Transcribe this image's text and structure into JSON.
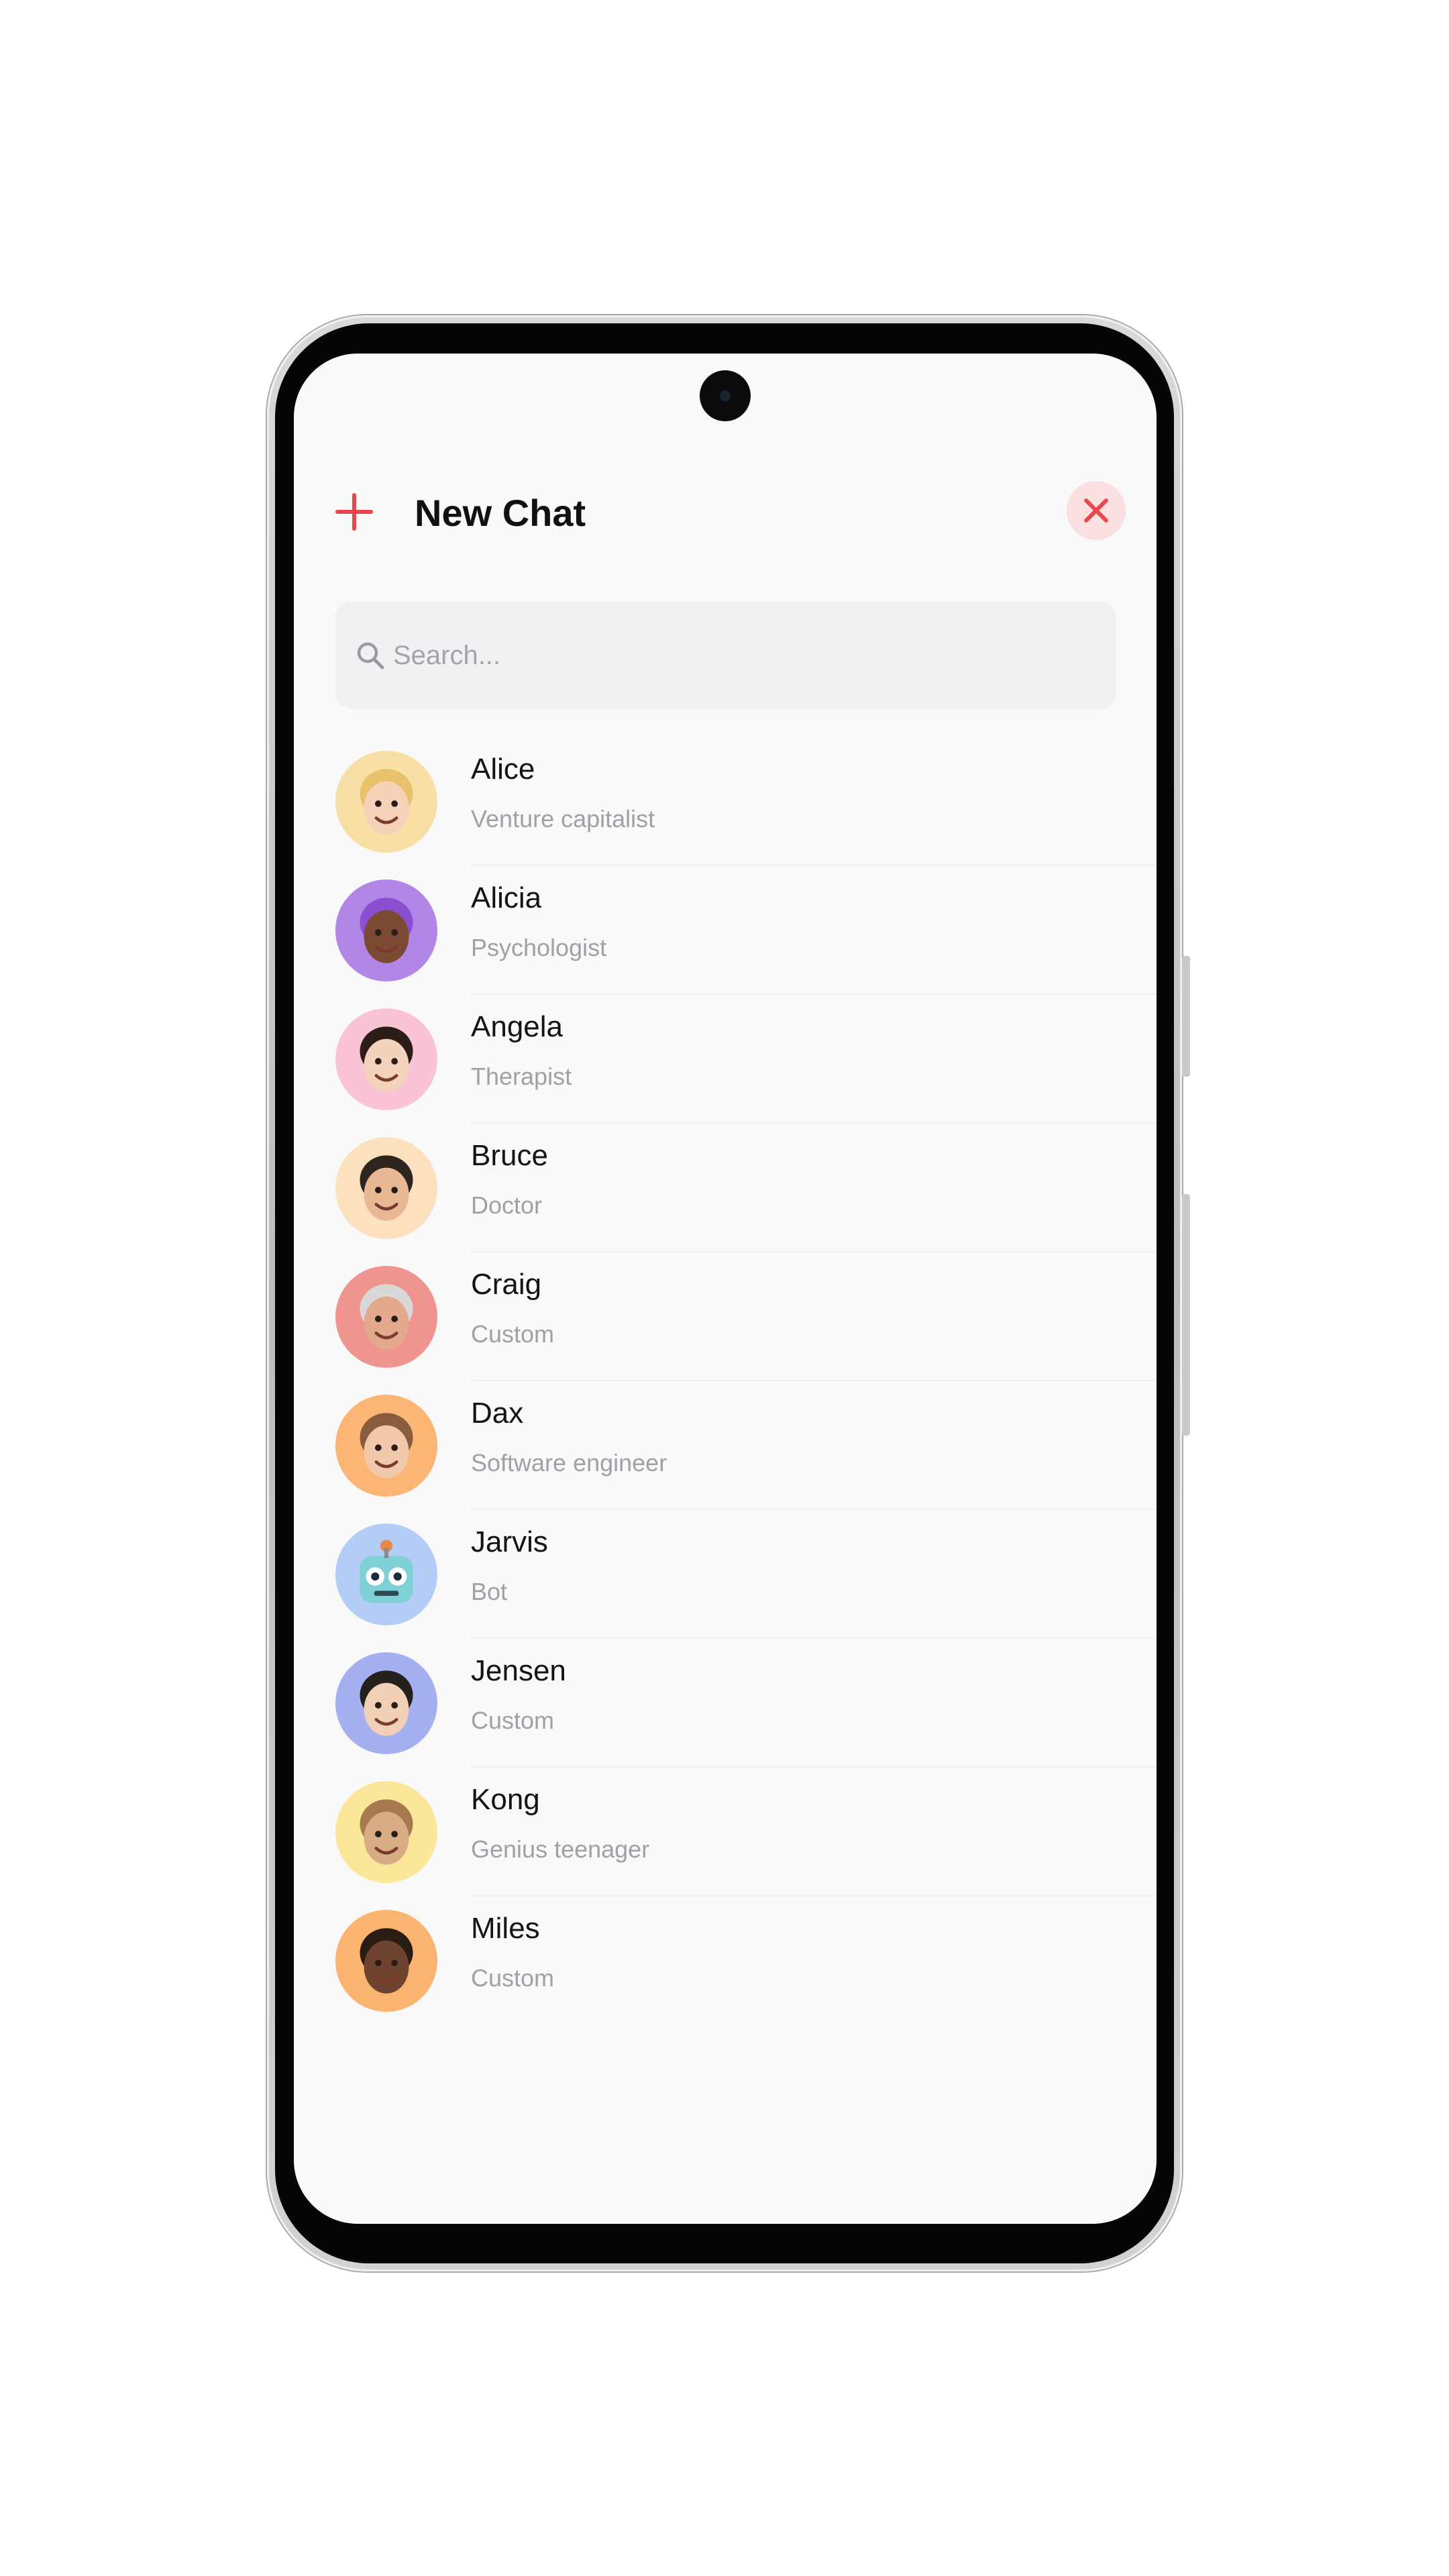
{
  "header": {
    "title": "New Chat",
    "add_icon": "plus-icon",
    "close_icon": "close-icon"
  },
  "search": {
    "placeholder": "Search...",
    "icon": "search-icon"
  },
  "colors": {
    "accent": "#e8474e",
    "close_bg": "#fbe0e1",
    "background": "#f9f9f9",
    "search_bg": "#f0f1f3"
  },
  "contacts": [
    {
      "name": "Alice",
      "role": "Venture capitalist",
      "avatar_bg": "#f7dfa5",
      "skin": "#f6d2b8",
      "hair": "#e9c16a"
    },
    {
      "name": "Alicia",
      "role": "Psychologist",
      "avatar_bg": "#b186e6",
      "skin": "#7a4a33",
      "hair": "#8a4fd0"
    },
    {
      "name": "Angela",
      "role": "Therapist",
      "avatar_bg": "#fbc3d6",
      "skin": "#f4d3bd",
      "hair": "#2b1d18"
    },
    {
      "name": "Bruce",
      "role": "Doctor",
      "avatar_bg": "#fde0bd",
      "skin": "#e8b894",
      "hair": "#2d2520"
    },
    {
      "name": "Craig",
      "role": "Custom",
      "avatar_bg": "#f0948f",
      "skin": "#e2a98d",
      "hair": "#d8d8d8"
    },
    {
      "name": "Dax",
      "role": "Software engineer",
      "avatar_bg": "#fbb676",
      "skin": "#f0c9aa",
      "hair": "#8a5c3e"
    },
    {
      "name": "Jarvis",
      "role": "Bot",
      "avatar_bg": "#b3cdf7",
      "skin": "#7fd1d6",
      "hair": "#e8894a"
    },
    {
      "name": "Jensen",
      "role": "Custom",
      "avatar_bg": "#a4b0ef",
      "skin": "#f2d0b8",
      "hair": "#26201c"
    },
    {
      "name": "Kong",
      "role": "Genius teenager",
      "avatar_bg": "#fbe79a",
      "skin": "#d8ad86",
      "hair": "#a8784e"
    },
    {
      "name": "Miles",
      "role": "Custom",
      "avatar_bg": "#fbb370",
      "skin": "#6e4330",
      "hair": "#2b1c14"
    }
  ]
}
